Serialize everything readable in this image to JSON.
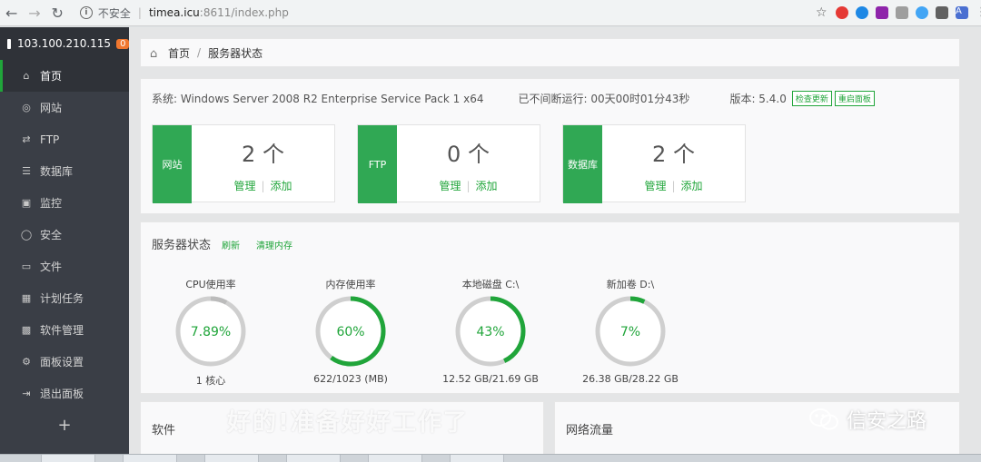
{
  "browser": {
    "insecure_label": "不安全",
    "host": "timea.icu",
    "path": ":8611/index.php",
    "avatar": "A"
  },
  "sidebar": {
    "server_ip": "103.100.210.115",
    "badge": "0",
    "items": [
      {
        "label": "首页",
        "icon": "home-icon"
      },
      {
        "label": "网站",
        "icon": "globe-icon"
      },
      {
        "label": "FTP",
        "icon": "ftp-icon"
      },
      {
        "label": "数据库",
        "icon": "database-icon"
      },
      {
        "label": "监控",
        "icon": "monitor-icon"
      },
      {
        "label": "安全",
        "icon": "shield-icon"
      },
      {
        "label": "文件",
        "icon": "folder-icon"
      },
      {
        "label": "计划任务",
        "icon": "calendar-icon"
      },
      {
        "label": "软件管理",
        "icon": "apps-icon"
      },
      {
        "label": "面板设置",
        "icon": "settings-icon"
      },
      {
        "label": "退出面板",
        "icon": "logout-icon"
      }
    ],
    "add_label": "+"
  },
  "breadcrumb": {
    "home": "首页",
    "separator": "/",
    "current": "服务器状态"
  },
  "system": {
    "os": "系统: Windows Server 2008 R2 Enterprise Service Pack 1 x64",
    "uptime": "已不间断运行: 00天00时01分43秒",
    "version": "版本: 5.4.0",
    "check_update": "检查更新",
    "restart_panel": "重启面板"
  },
  "tiles": [
    {
      "label": "网站",
      "count": "2 个",
      "manage": "管理",
      "add": "添加"
    },
    {
      "label": "FTP",
      "count": "0 个",
      "manage": "管理",
      "add": "添加"
    },
    {
      "label": "数据库",
      "count": "2 个",
      "manage": "管理",
      "add": "添加"
    }
  ],
  "status": {
    "title": "服务器状态",
    "refresh": "刷新",
    "clear_memory": "清理内存",
    "gauges": [
      {
        "title": "CPU使用率",
        "value": "7.89%",
        "percent": 7.89,
        "detail": "1 核心",
        "color": "#bbbbbb"
      },
      {
        "title": "内存使用率",
        "value": "60%",
        "percent": 60,
        "detail": "622/1023 (MB)",
        "color": "#20a53a"
      },
      {
        "title": "本地磁盘 C:\\",
        "value": "43%",
        "percent": 43,
        "detail": "12.52 GB/21.69 GB",
        "color": "#20a53a"
      },
      {
        "title": "新加卷 D:\\",
        "value": "7%",
        "percent": 7,
        "detail": "26.38 GB/28.22 GB",
        "color": "#20a53a"
      }
    ]
  },
  "bottom": {
    "software": "软件",
    "network": "网络流量"
  },
  "overlay": {
    "caption": "好的!准备好好工作了",
    "watermark": "信安之路"
  },
  "colors": {
    "accent": "#20a53a",
    "sidebar": "#3a3e46",
    "badge": "#f0772f"
  }
}
